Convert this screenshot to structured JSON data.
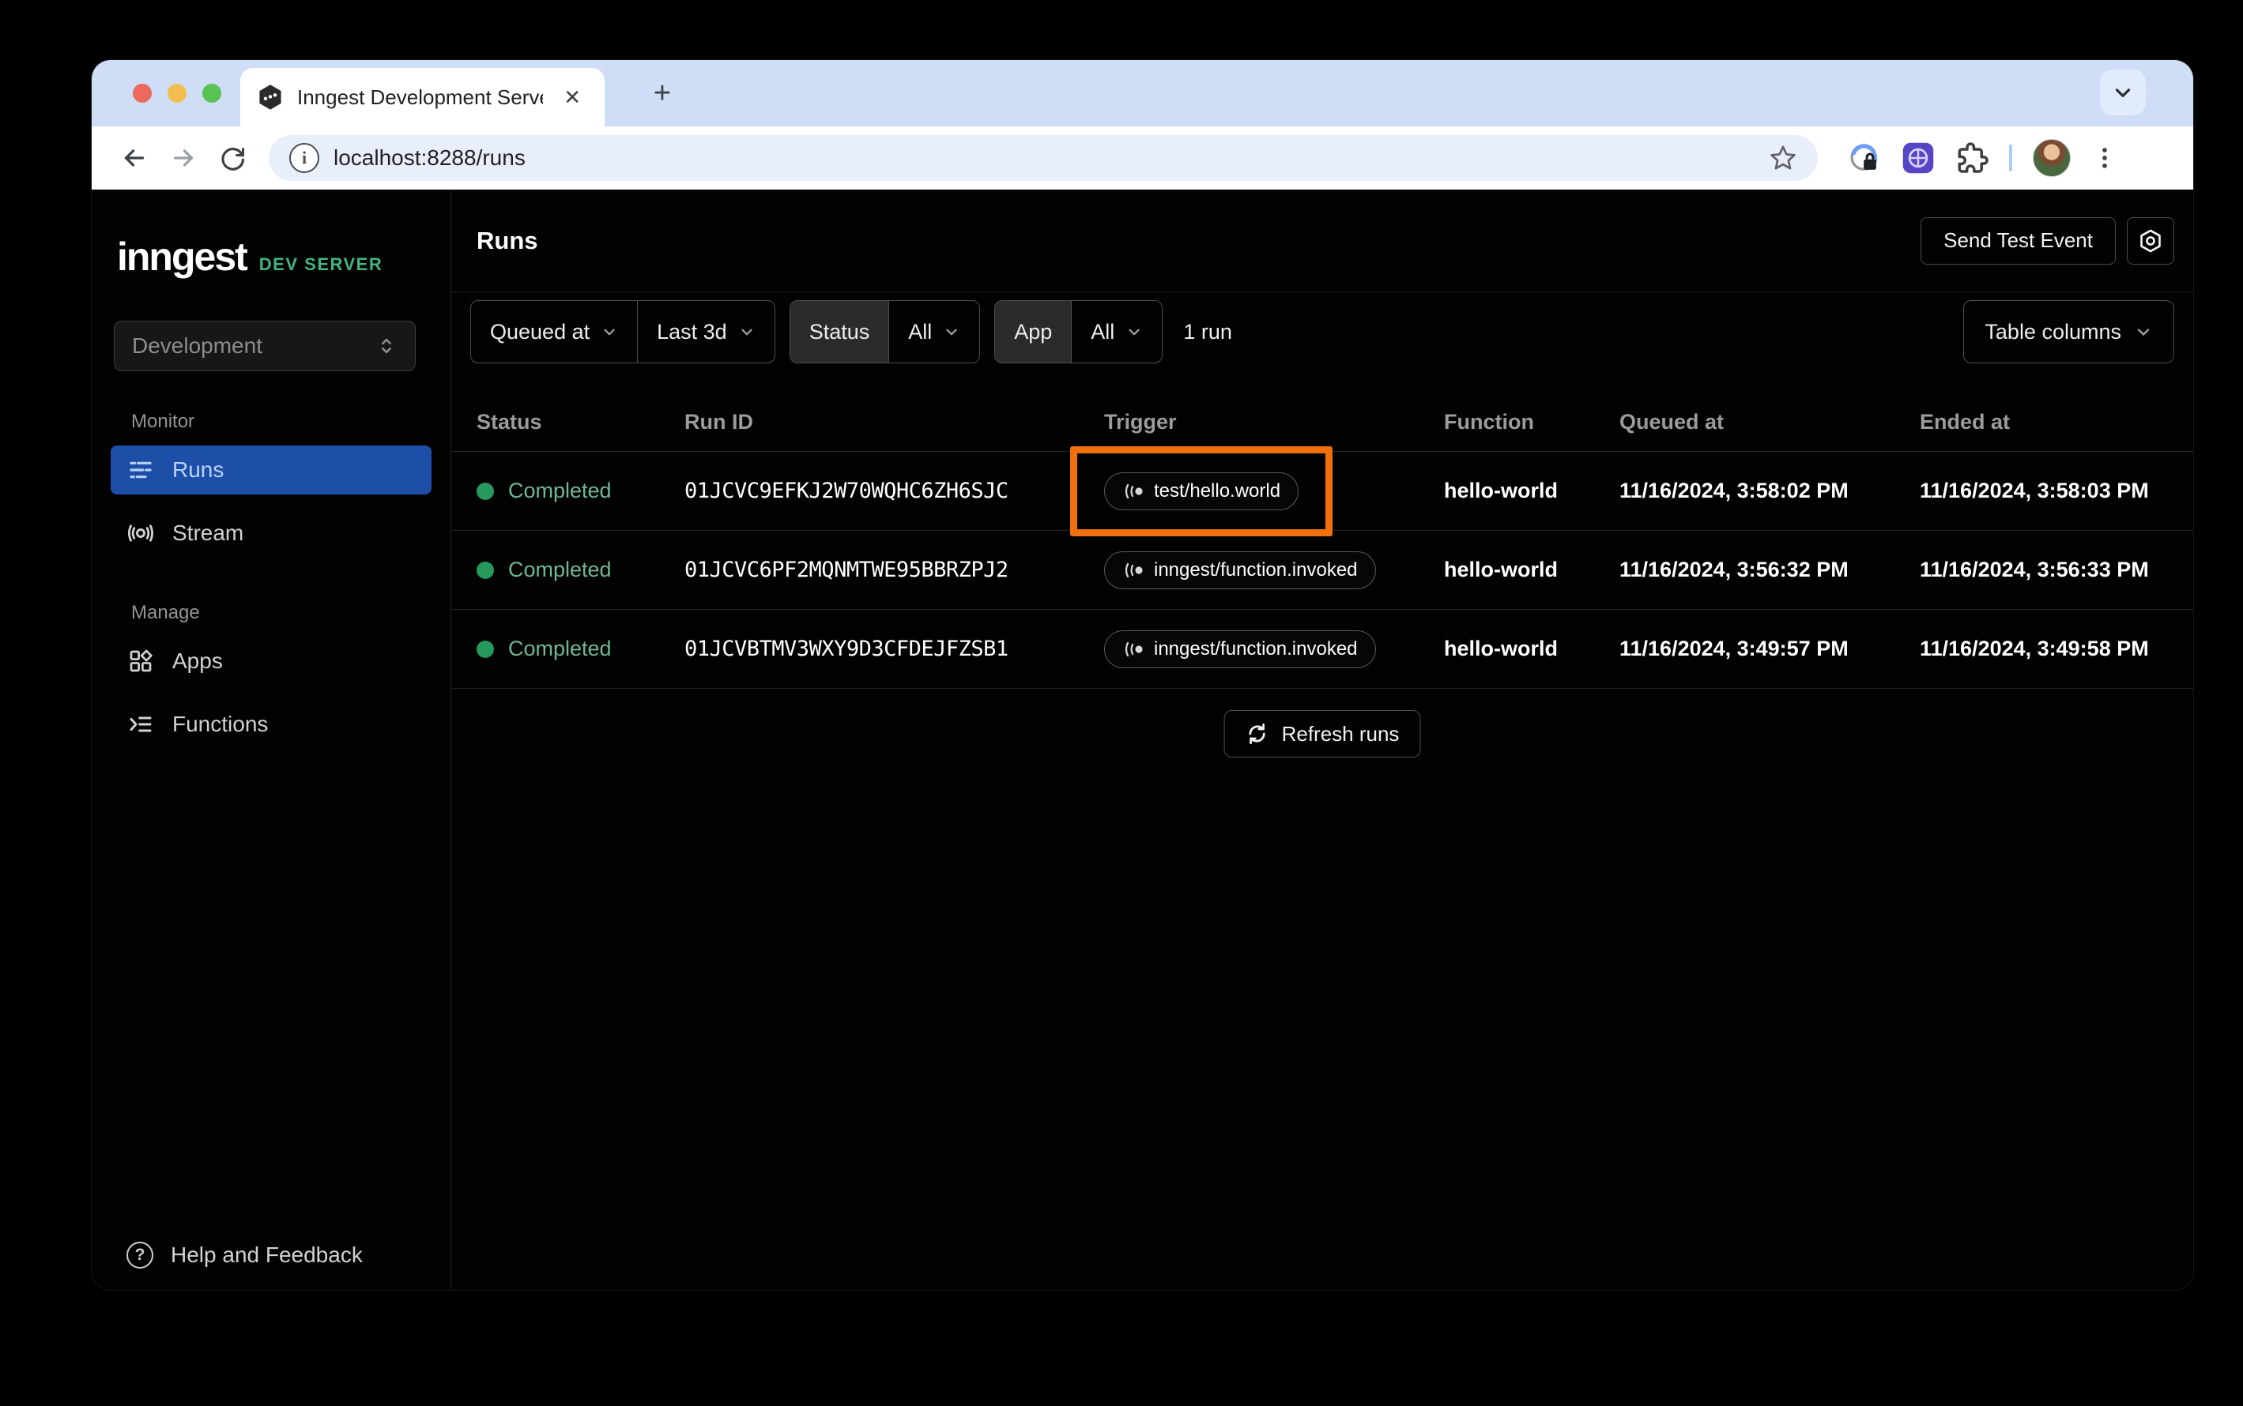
{
  "browser": {
    "tab_title": "Inngest Development Server",
    "close_tab_glyph": "✕",
    "new_tab_glyph": "+",
    "url": "localhost:8288/runs"
  },
  "sidebar": {
    "logo": "inngest",
    "logo_badge": "DEV SERVER",
    "env_selector": "Development",
    "sections": [
      {
        "label": "Monitor",
        "items": [
          {
            "label": "Runs",
            "icon": "runs-icon",
            "active": true
          },
          {
            "label": "Stream",
            "icon": "stream-icon",
            "active": false
          }
        ]
      },
      {
        "label": "Manage",
        "items": [
          {
            "label": "Apps",
            "icon": "apps-icon",
            "active": false
          },
          {
            "label": "Functions",
            "icon": "functions-icon",
            "active": false
          }
        ]
      }
    ],
    "help": "Help and Feedback"
  },
  "header": {
    "title": "Runs",
    "send_test_event": "Send Test Event",
    "settings_icon": "gear-hexagon-icon"
  },
  "filters": {
    "field": "Queued at",
    "range": "Last 3d",
    "status_label": "Status",
    "status_value": "All",
    "app_label": "App",
    "app_value": "All",
    "run_count": "1 run",
    "table_columns": "Table columns"
  },
  "table": {
    "columns": [
      "Status",
      "Run ID",
      "Trigger",
      "Function",
      "Queued at",
      "Ended at"
    ],
    "rows": [
      {
        "status": "Completed",
        "run_id": "01JCVC9EFKJ2W70WQHC6ZH6SJC",
        "trigger": "test/hello.world",
        "function": "hello-world",
        "queued_at": "11/16/2024, 3:58:02 PM",
        "ended_at": "11/16/2024, 3:58:03 PM",
        "highlighted": true
      },
      {
        "status": "Completed",
        "run_id": "01JCVC6PF2MQNMTWE95BBRZPJ2",
        "trigger": "inngest/function.invoked",
        "function": "hello-world",
        "queued_at": "11/16/2024, 3:56:32 PM",
        "ended_at": "11/16/2024, 3:56:33 PM",
        "highlighted": false
      },
      {
        "status": "Completed",
        "run_id": "01JCVBTMV3WXY9D3CFDEJFZSB1",
        "trigger": "inngest/function.invoked",
        "function": "hello-world",
        "queued_at": "11/16/2024, 3:49:57 PM",
        "ended_at": "11/16/2024, 3:49:58 PM",
        "highlighted": false
      }
    ],
    "refresh_label": "Refresh runs"
  },
  "colors": {
    "annotation_orange": "#f1700e",
    "active_nav_blue": "#1d4fa8",
    "active_nav_text": "#b7d2f9",
    "status_green_dot": "#27995d",
    "status_green_text": "#70b894",
    "dev_server_green": "#44b57f",
    "tab_strip_blue": "#cfddf7",
    "app_background": "#020202"
  }
}
